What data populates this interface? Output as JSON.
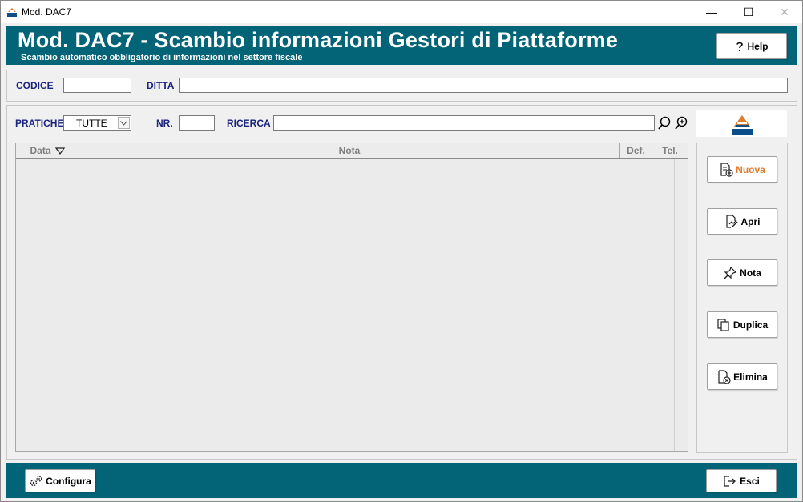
{
  "window": {
    "title": "Mod. DAC7",
    "controls": {
      "minimize": "—",
      "maximize": "☐",
      "close": "✕"
    }
  },
  "header": {
    "title": "Mod. DAC7 - Scambio informazioni Gestori di Piattaforme",
    "subtitle": "Scambio automatico obbligatorio di informazioni nel settore fiscale",
    "help_label": "Help"
  },
  "filters": {
    "codice_label": "CODICE",
    "codice_value": "",
    "ditta_label": "DITTA",
    "ditta_value": "",
    "pratiche_label": "PRATICHE",
    "pratiche_selected": "TUTTE",
    "nr_label": "NR.",
    "nr_value": "",
    "ricerca_label": "RICERCA",
    "ricerca_value": ""
  },
  "table": {
    "columns": [
      "Data",
      "Nota",
      "Def.",
      "Tel."
    ],
    "rows": []
  },
  "actions": {
    "nuova": "Nuova",
    "apri": "Apri",
    "nota": "Nota",
    "duplica": "Duplica",
    "elimina": "Elimina"
  },
  "footer": {
    "configura": "Configura",
    "esci": "Esci"
  },
  "colors": {
    "header_bg": "#036478",
    "label_text": "#1a237e",
    "nuova_text": "#e07b2a"
  }
}
